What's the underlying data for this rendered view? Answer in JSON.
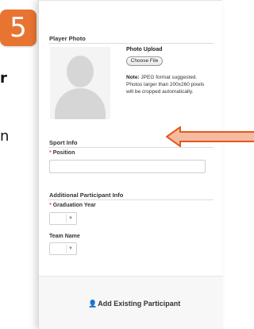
{
  "slide": {
    "step_number": "5",
    "side_text_1": "r",
    "side_text_2": "n"
  },
  "form": {
    "player_photo": {
      "title": "Player Photo",
      "upload_label": "Photo Upload",
      "choose_file_label": "Choose File",
      "note_bold": "Note:",
      "note_text": "JPEG format suggested. Photos larger than 200x260 pixels will be cropped automatically."
    },
    "sport_info": {
      "title": "Sport Info",
      "position_label": "Position",
      "position_value": "",
      "required_marker": "*"
    },
    "additional_info": {
      "title": "Additional Participant Info",
      "graduation_year_label": "Graduation Year",
      "graduation_year_value": "",
      "team_name_label": "Team Name",
      "team_name_value": "",
      "required_marker": "*"
    },
    "add_existing_participant": "Add Existing Participant"
  },
  "icons": {
    "user": "user-icon",
    "caret": "caret-down-icon",
    "arrow": "arrow-left-icon"
  },
  "colors": {
    "badge": "#e87432",
    "arrow_fill": "#f5bba0",
    "arrow_stroke": "#e4571f",
    "required": "#d9534f"
  }
}
